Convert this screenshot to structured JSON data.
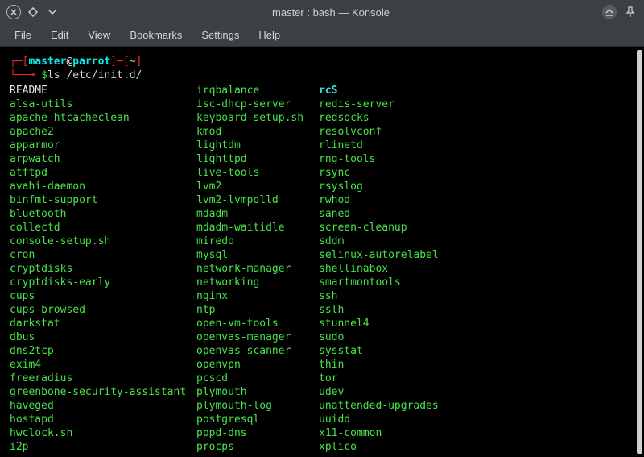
{
  "window": {
    "title": "master : bash — Konsole"
  },
  "menubar": {
    "file": "File",
    "edit": "Edit",
    "view": "View",
    "bookmarks": "Bookmarks",
    "settings": "Settings",
    "help": "Help"
  },
  "prompt": {
    "line1_open": "┌─[",
    "user": "master",
    "at": "@",
    "host": "parrot",
    "line1_close": "]─[",
    "cwd": "~",
    "line1_end": "]",
    "line2_prefix": "└──╼ ",
    "dollar": "$",
    "command": "ls /etc/init.d/"
  },
  "listing": [
    {
      "c1": {
        "t": "README",
        "cls": "white"
      },
      "c2": {
        "t": "irqbalance",
        "cls": "green"
      },
      "c3": {
        "t": "rcS",
        "cls": "cyanf"
      }
    },
    {
      "c1": {
        "t": "alsa-utils",
        "cls": "green"
      },
      "c2": {
        "t": "isc-dhcp-server",
        "cls": "green"
      },
      "c3": {
        "t": "redis-server",
        "cls": "green"
      }
    },
    {
      "c1": {
        "t": "apache-htcacheclean",
        "cls": "green"
      },
      "c2": {
        "t": "keyboard-setup.sh",
        "cls": "green"
      },
      "c3": {
        "t": "redsocks",
        "cls": "green"
      }
    },
    {
      "c1": {
        "t": "apache2",
        "cls": "green"
      },
      "c2": {
        "t": "kmod",
        "cls": "green"
      },
      "c3": {
        "t": "resolvconf",
        "cls": "green"
      }
    },
    {
      "c1": {
        "t": "apparmor",
        "cls": "green"
      },
      "c2": {
        "t": "lightdm",
        "cls": "green"
      },
      "c3": {
        "t": "rlinetd",
        "cls": "green"
      }
    },
    {
      "c1": {
        "t": "arpwatch",
        "cls": "green"
      },
      "c2": {
        "t": "lighttpd",
        "cls": "green"
      },
      "c3": {
        "t": "rng-tools",
        "cls": "green"
      }
    },
    {
      "c1": {
        "t": "atftpd",
        "cls": "green"
      },
      "c2": {
        "t": "live-tools",
        "cls": "green"
      },
      "c3": {
        "t": "rsync",
        "cls": "green"
      }
    },
    {
      "c1": {
        "t": "avahi-daemon",
        "cls": "green"
      },
      "c2": {
        "t": "lvm2",
        "cls": "green"
      },
      "c3": {
        "t": "rsyslog",
        "cls": "green"
      }
    },
    {
      "c1": {
        "t": "binfmt-support",
        "cls": "green"
      },
      "c2": {
        "t": "lvm2-lvmpolld",
        "cls": "green"
      },
      "c3": {
        "t": "rwhod",
        "cls": "green"
      }
    },
    {
      "c1": {
        "t": "bluetooth",
        "cls": "green"
      },
      "c2": {
        "t": "mdadm",
        "cls": "green"
      },
      "c3": {
        "t": "saned",
        "cls": "green"
      }
    },
    {
      "c1": {
        "t": "collectd",
        "cls": "green"
      },
      "c2": {
        "t": "mdadm-waitidle",
        "cls": "green"
      },
      "c3": {
        "t": "screen-cleanup",
        "cls": "green"
      }
    },
    {
      "c1": {
        "t": "console-setup.sh",
        "cls": "green"
      },
      "c2": {
        "t": "miredo",
        "cls": "green"
      },
      "c3": {
        "t": "sddm",
        "cls": "green"
      }
    },
    {
      "c1": {
        "t": "cron",
        "cls": "green"
      },
      "c2": {
        "t": "mysql",
        "cls": "green"
      },
      "c3": {
        "t": "selinux-autorelabel",
        "cls": "green"
      }
    },
    {
      "c1": {
        "t": "cryptdisks",
        "cls": "green"
      },
      "c2": {
        "t": "network-manager",
        "cls": "green"
      },
      "c3": {
        "t": "shellinabox",
        "cls": "green"
      }
    },
    {
      "c1": {
        "t": "cryptdisks-early",
        "cls": "green"
      },
      "c2": {
        "t": "networking",
        "cls": "green"
      },
      "c3": {
        "t": "smartmontools",
        "cls": "green"
      }
    },
    {
      "c1": {
        "t": "cups",
        "cls": "green"
      },
      "c2": {
        "t": "nginx",
        "cls": "green"
      },
      "c3": {
        "t": "ssh",
        "cls": "green"
      }
    },
    {
      "c1": {
        "t": "cups-browsed",
        "cls": "green"
      },
      "c2": {
        "t": "ntp",
        "cls": "green"
      },
      "c3": {
        "t": "sslh",
        "cls": "green"
      }
    },
    {
      "c1": {
        "t": "darkstat",
        "cls": "green"
      },
      "c2": {
        "t": "open-vm-tools",
        "cls": "green"
      },
      "c3": {
        "t": "stunnel4",
        "cls": "green"
      }
    },
    {
      "c1": {
        "t": "dbus",
        "cls": "green"
      },
      "c2": {
        "t": "openvas-manager",
        "cls": "green"
      },
      "c3": {
        "t": "sudo",
        "cls": "green"
      }
    },
    {
      "c1": {
        "t": "dns2tcp",
        "cls": "green"
      },
      "c2": {
        "t": "openvas-scanner",
        "cls": "green"
      },
      "c3": {
        "t": "sysstat",
        "cls": "green"
      }
    },
    {
      "c1": {
        "t": "exim4",
        "cls": "green"
      },
      "c2": {
        "t": "openvpn",
        "cls": "green"
      },
      "c3": {
        "t": "thin",
        "cls": "green"
      }
    },
    {
      "c1": {
        "t": "freeradius",
        "cls": "green"
      },
      "c2": {
        "t": "pcscd",
        "cls": "green"
      },
      "c3": {
        "t": "tor",
        "cls": "green"
      }
    },
    {
      "c1": {
        "t": "greenbone-security-assistant",
        "cls": "green"
      },
      "c2": {
        "t": "plymouth",
        "cls": "green"
      },
      "c3": {
        "t": "udev",
        "cls": "green"
      }
    },
    {
      "c1": {
        "t": "haveged",
        "cls": "green"
      },
      "c2": {
        "t": "plymouth-log",
        "cls": "green"
      },
      "c3": {
        "t": "unattended-upgrades",
        "cls": "green"
      }
    },
    {
      "c1": {
        "t": "hostapd",
        "cls": "green"
      },
      "c2": {
        "t": "postgresql",
        "cls": "green"
      },
      "c3": {
        "t": "uuidd",
        "cls": "green"
      }
    },
    {
      "c1": {
        "t": "hwclock.sh",
        "cls": "green"
      },
      "c2": {
        "t": "pppd-dns",
        "cls": "green"
      },
      "c3": {
        "t": "x11-common",
        "cls": "green"
      }
    },
    {
      "c1": {
        "t": "i2p",
        "cls": "green"
      },
      "c2": {
        "t": "procps",
        "cls": "green"
      },
      "c3": {
        "t": "xplico",
        "cls": "green"
      }
    }
  ]
}
